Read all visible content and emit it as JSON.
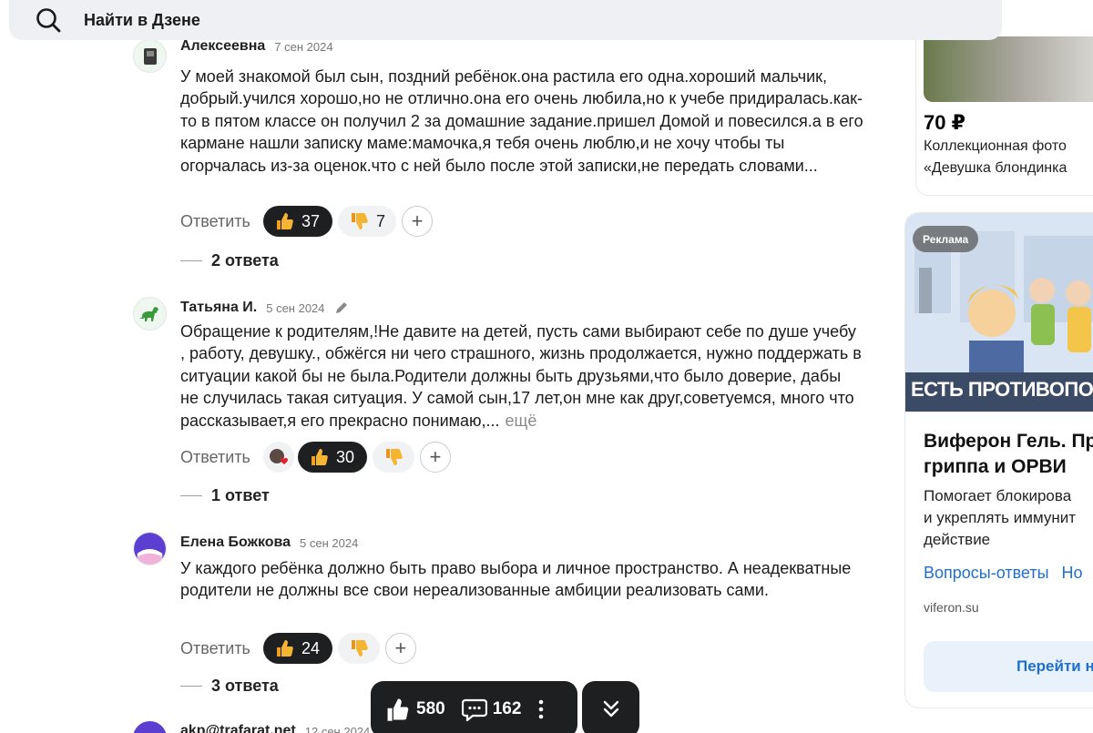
{
  "search": {
    "label": "Найти в Дзене"
  },
  "comments": [
    {
      "author": "Алексеевна",
      "date": "7 сен 2024",
      "text": "У моей знакомой был сын, поздний ребёнок.она растила его одна.хороший мальчик, добрый.учился хорошо,но не отлично.она его очень любила,но к учебе придиралась.как-то в пятом классе он получил 2 за домашние задание.пришел Домой и повесился.а в его кармане нашли записку маме:мамочка,я тебя очень люблю,и не хочу чтобы ты огорчалась из-за оценок.что с ней было после этой записки,не передать словами...",
      "reply_label": "Ответить",
      "likes": "37",
      "dislikes": "7",
      "replies_label": "2 ответа"
    },
    {
      "author": "Татьяна И.",
      "date": "5 сен 2024",
      "text": "Обращение к родителям,!Не давите на детей, пусть сами выбирают себе по душе учебу , работу, девушку., обжёгся ни чего страшного, жизнь продолжается, нужно поддержать в ситуации какой бы не была.Родители должны быть друзьями,что было доверие, дабы не случилась такая ситуация. У самой сын,17 лет,он мне как друг,советуемся, много что рассказывает,я его прекрасно понимаю,...",
      "more_label": "ещё",
      "reply_label": "Ответить",
      "likes": "30",
      "replies_label": "1 ответ"
    },
    {
      "author": "Елена Божкова",
      "date": "5 сен 2024",
      "text": "У каждого ребёнка должно быть право выбора и личное пространство. А неадекватные родители не должны все свои нереализованные амбиции реализовать сами.",
      "reply_label": "Ответить",
      "likes": "24",
      "replies_label": "3 ответа"
    },
    {
      "author": "akp@trafarat.net",
      "date": "12 сен 2024"
    }
  ],
  "sidebar": {
    "product": {
      "price": "70 ₽",
      "desc_line1": "Коллекционная фото",
      "desc_line2": "«Девушка блондинка"
    },
    "ad": {
      "badge": "Реклама",
      "image_caption": "ЕСТЬ ПРОТИВОПОКАЗАНИЯ.П",
      "title_line1": "Виферон Гель. Пр",
      "title_line2": "гриппа и ОРВИ",
      "body_line1": "Помогает блокирова",
      "body_line2": "и укреплять иммунит",
      "body_line3": "действие",
      "link1": "Вопросы-ответы",
      "link2": "Но",
      "domain": "viferon.su",
      "button": "Перейти н"
    }
  },
  "floating_bar": {
    "likes": "580",
    "comments": "162"
  },
  "colors": {
    "dark_pill": "#1e1f21",
    "link_blue": "#1e6fd0",
    "search_bg": "#eef0f3"
  }
}
